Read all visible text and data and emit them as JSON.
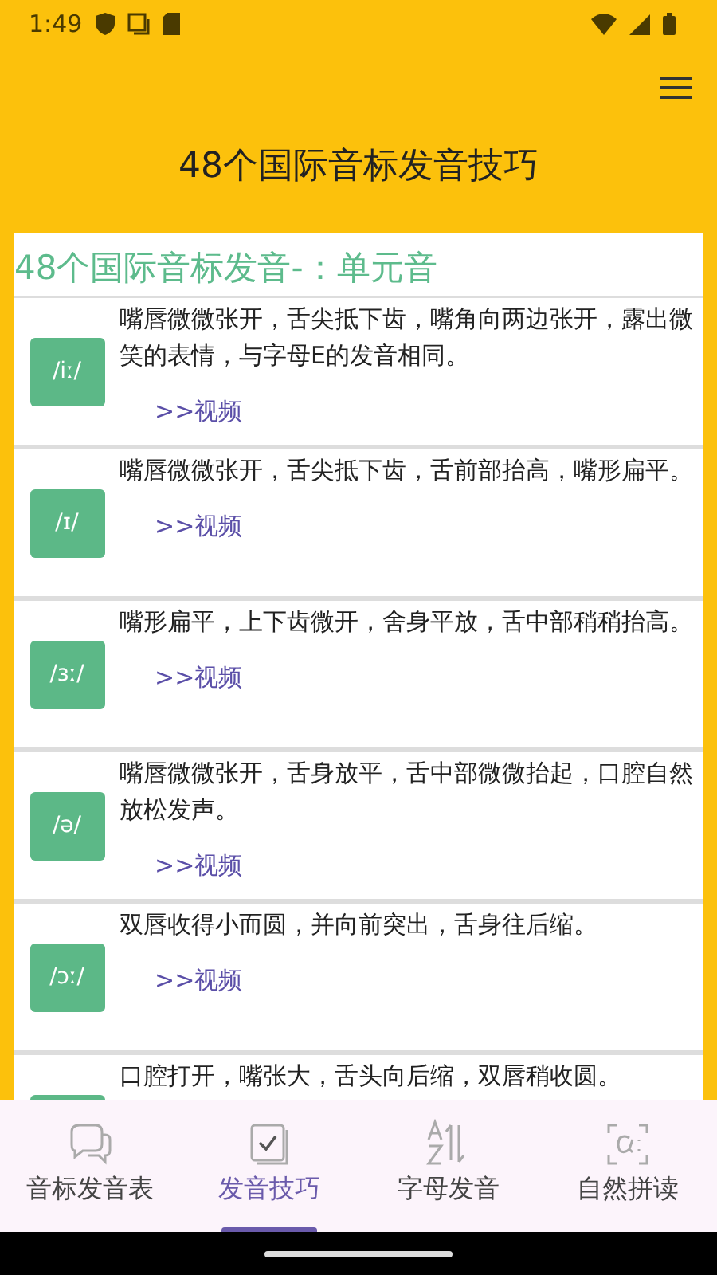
{
  "status_bar": {
    "time": "1:49"
  },
  "app_bar": {
    "title": "48个国际音标发音技巧"
  },
  "section": {
    "heading": "48个国际音标发音-：单元音",
    "items": [
      {
        "phonetic": "/iː/",
        "description": "嘴唇微微张开，舌尖抵下齿，嘴角向两边张开，露出微笑的表情，与字母E的发音相同。",
        "link": ">>视频"
      },
      {
        "phonetic": "/ɪ/",
        "description": "嘴唇微微张开，舌尖抵下齿，舌前部抬高，嘴形扁平。",
        "link": ">>视频"
      },
      {
        "phonetic": "/ɜː/",
        "description": "嘴形扁平，上下齿微开，舍身平放，舌中部稍稍抬高。",
        "link": ">>视频"
      },
      {
        "phonetic": "/ə/",
        "description": "嘴唇微微张开，舌身放平，舌中部微微抬起，口腔自然放松发声。",
        "link": ">>视频"
      },
      {
        "phonetic": "/ɔː/",
        "description": "双唇收得小而圆，并向前突出，舌身往后缩。",
        "link": ">>视频"
      },
      {
        "description": "口腔打开，嘴张大，舌头向后缩，双唇稍收圆。"
      }
    ]
  },
  "bottom_nav": [
    {
      "label": "音标发音表",
      "kind": "chat",
      "selected": false
    },
    {
      "label": "发音技巧",
      "kind": "check",
      "selected": true
    },
    {
      "label": "字母发音",
      "kind": "az",
      "selected": false
    },
    {
      "label": "自然拼读",
      "kind": "alpha",
      "selected": false
    }
  ]
}
